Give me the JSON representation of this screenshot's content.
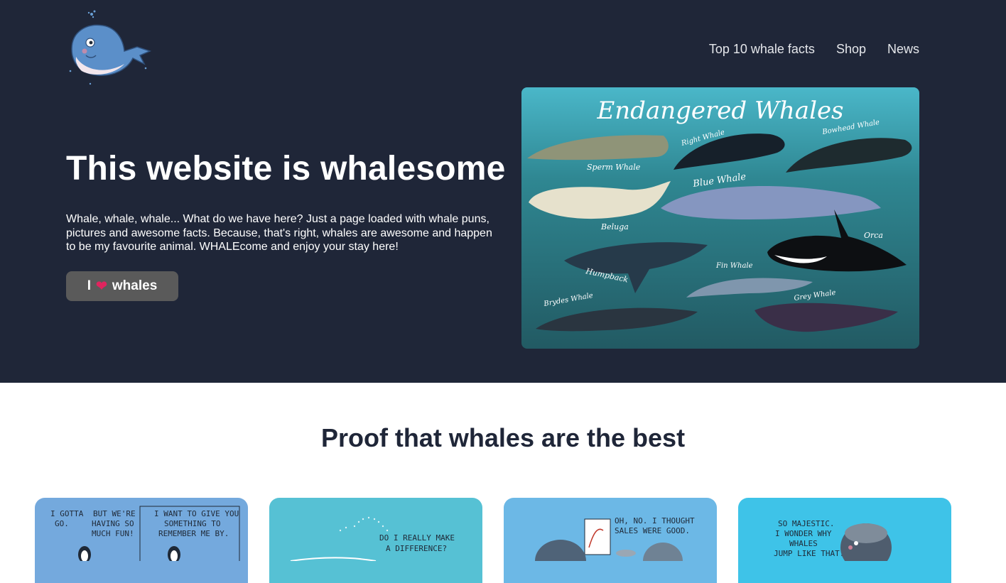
{
  "header": {
    "logo_icon": "whale-logo",
    "nav": [
      {
        "label": "Top 10 whale facts"
      },
      {
        "label": "Shop"
      },
      {
        "label": "News"
      }
    ]
  },
  "hero": {
    "title": "This website is whalesome",
    "intro": "Whale, whale, whale... What do we have here? Just a page loaded with whale puns, pictures and awesome facts. Because, that's right, whales are awesome and happen to be my favourite animal. WHALEcome and enjoy your stay here!",
    "cta": {
      "prefix": "I",
      "icon": "heart-icon",
      "suffix": "whales"
    },
    "image": {
      "title": "Endangered Whales",
      "labels": [
        "Sperm Whale",
        "Right Whale",
        "Bowhead Whale",
        "Blue Whale",
        "Beluga",
        "Orca",
        "Humpback",
        "Fin Whale",
        "Brydes Whale",
        "Grey Whale"
      ]
    }
  },
  "proof": {
    "title": "Proof that whales are the best",
    "cards": [
      {
        "lines_a": [
          "I GOTTA",
          "GO."
        ],
        "lines_b": [
          "BUT WE'RE",
          "HAVING SO",
          "MUCH FUN!"
        ],
        "lines_c": [
          "I WANT TO GIVE YOU",
          "SOMETHING TO",
          "REMEMBER ME BY."
        ]
      },
      {
        "lines_a": [
          "DO I REALLY MAKE",
          "A DIFFERENCE?"
        ]
      },
      {
        "lines_a": [
          "OH, NO. I THOUGHT",
          "SALES WERE GOOD."
        ]
      },
      {
        "lines_a": [
          "SO MAJESTIC.",
          "I WONDER WHY",
          "WHALES",
          "JUMP LIKE THAT."
        ]
      }
    ]
  },
  "colors": {
    "hero_bg": "#1f2638",
    "button_bg": "#5a5a5a",
    "heart": "#e0245e",
    "card1": "#74a9dd",
    "card2": "#56c1d4",
    "card3": "#6cb8e6",
    "card4": "#3ec3e8"
  }
}
